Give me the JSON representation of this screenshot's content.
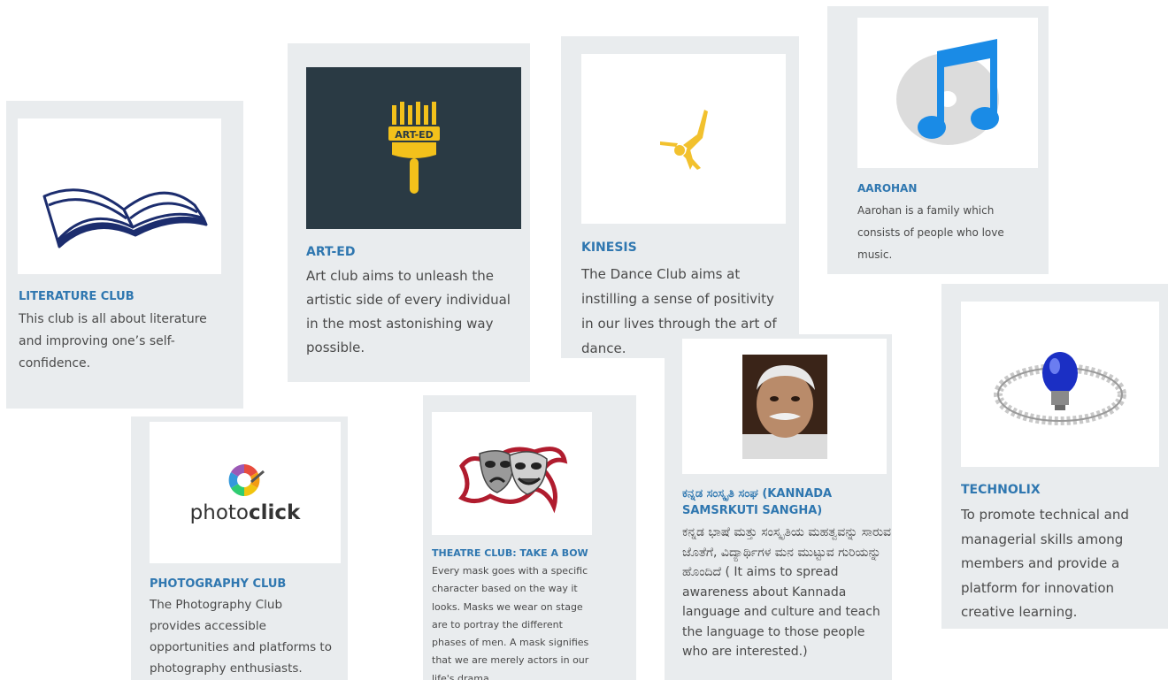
{
  "cards": {
    "literature": {
      "title": "LITERATURE CLUB",
      "description": "This club is all about literature and improving one’s self-confidence.",
      "icon": "open-book-icon"
    },
    "arted": {
      "title": "ART-ED",
      "description": "Art club aims to unleash the artistic side of every individual in the most astonishing way possible.",
      "logo_text": "ART-ED",
      "icon": "paintbrush-logo-icon"
    },
    "kinesis": {
      "title": "KINESIS",
      "description": "The Dance Club aims at instilling a sense of positivity in our lives through the art of dance.",
      "icon": "dancer-icon"
    },
    "aarohan": {
      "title": "AAROHAN",
      "description": "Aarohan is a family which consists of people who love music.",
      "icon": "music-note-icon"
    },
    "technolix": {
      "title": "TECHNOLIX",
      "description": "To promote technical and managerial skills among members and provide a platform for innovation creative learning.",
      "icon": "lightbulb-people-icon"
    },
    "photography": {
      "title": "PHOTOGRAPHY CLUB",
      "description": "The Photography Club provides accessible opportunities and platforms to photography enthusiasts.",
      "logo_text_a": "photo",
      "logo_text_b": "click",
      "icon": "camera-aperture-icon"
    },
    "theatre": {
      "title": "THEATRE CLUB: TAKE A BOW",
      "description": "Every mask goes with a specific character based on the way it looks. Masks we wear on stage are to portray the different phases of men. A mask signifies that we are merely actors in our life's drama.",
      "icon": "theatre-masks-icon"
    },
    "kannada": {
      "title_line1": "ಕನ್ನಡ ಸಂಸ್ಕೃತಿ ಸಂಘ (KANNADA",
      "title_line2": "SAMSRKUTI SANGHA)",
      "description": "ಕನ್ನಡ ಭಾಷೆ ಮತ್ತು ಸಂಸ್ಕೃತಿಯ ಮಹತ್ವವನ್ನು ಸಾರುವ ಜೊತೆಗೆ, ವಿದ್ಯಾರ್ಥಿಗಳ ಮನ ಮುಟ್ಟುವ ಗುರಿಯನ್ನು ಹೊಂದಿದೆ ( It aims to spread awareness about Kannada language and culture and teach the language to those people who are interested.)",
      "icon": "portrait-photo-icon"
    }
  },
  "colors": {
    "title_blue": "#2f77b0",
    "card_bg": "#e9ecee",
    "arted_bg": "#2a3a44",
    "arted_yellow": "#f3c11b",
    "dance_yellow": "#f2c12e",
    "music_blue": "#1a8be6"
  }
}
